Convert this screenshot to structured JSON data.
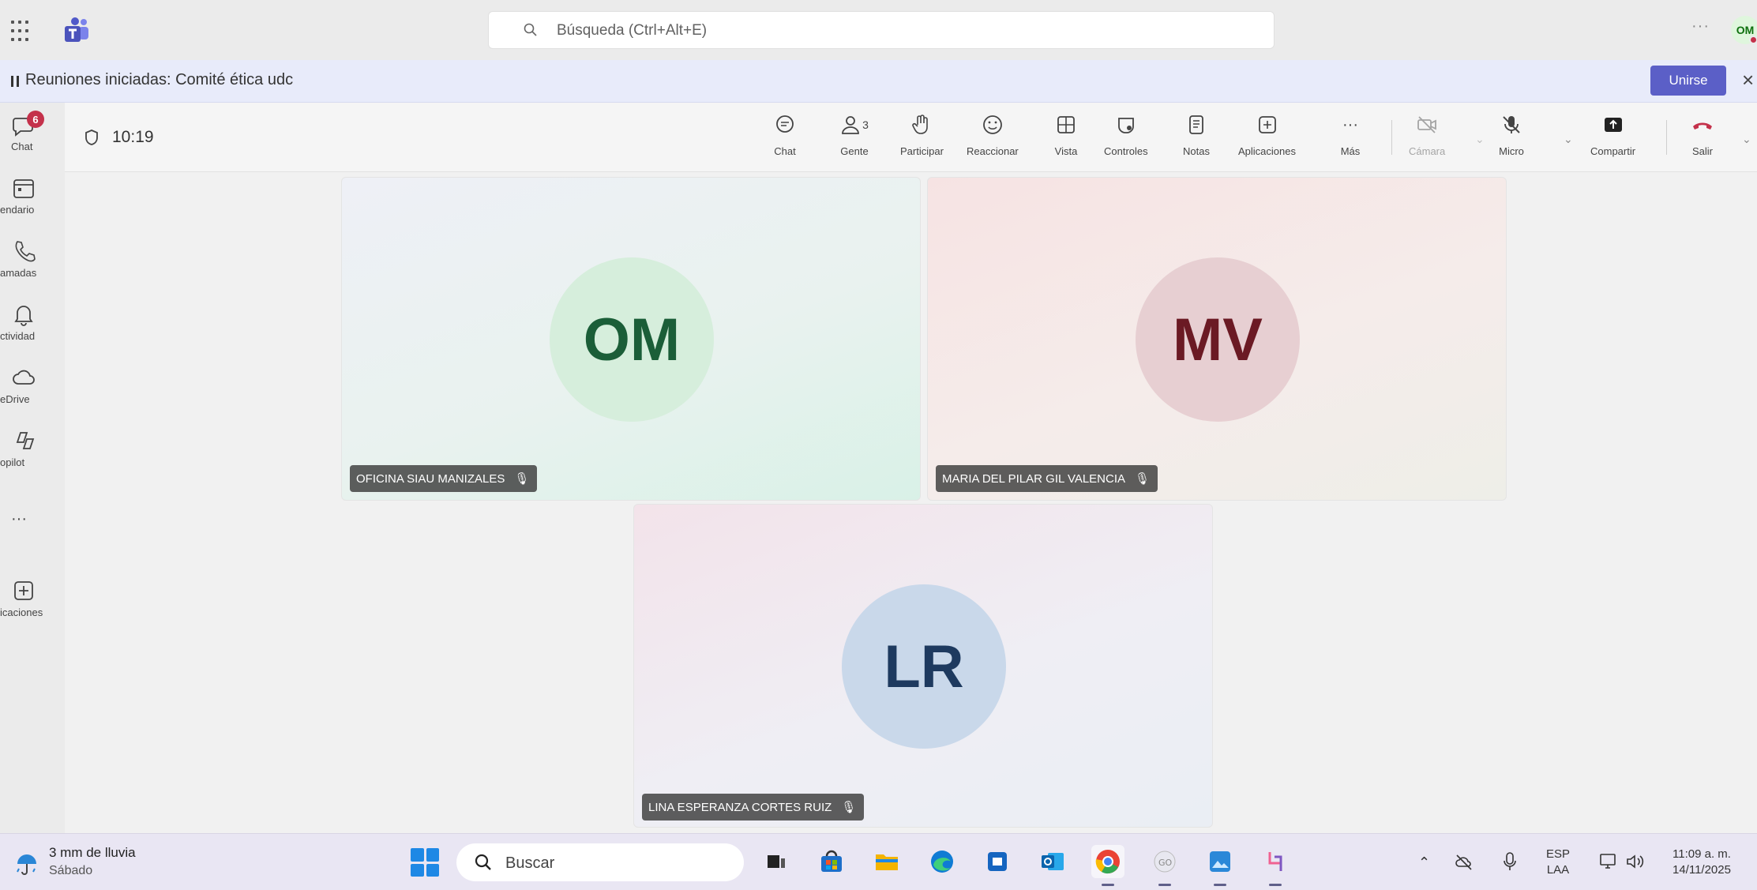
{
  "titlebar": {
    "search_placeholder": "Búsqueda (Ctrl+Alt+E)",
    "more": "···",
    "avatar_initials": "OM"
  },
  "banner": {
    "text": "Reuniones iniciadas: Comité ética udc",
    "join_label": "Unirse",
    "close": "×"
  },
  "rail": {
    "chat_badge": "6",
    "items": [
      {
        "label": "Chat",
        "icon": "chat-icon"
      },
      {
        "label": "endario",
        "icon": "calendar-icon"
      },
      {
        "label": "amadas",
        "icon": "phone-icon"
      },
      {
        "label": "ctividad",
        "icon": "bell-icon"
      },
      {
        "label": "eDrive",
        "icon": "cloud-icon"
      },
      {
        "label": "opilot",
        "icon": "copilot-icon"
      },
      {
        "label": "",
        "icon": "more-icon"
      },
      {
        "label": "icaciones",
        "icon": "add-apps-icon"
      }
    ],
    "more": "···"
  },
  "meeting": {
    "timer": "10:19",
    "people_count": "3",
    "toolbar": {
      "chat": "Chat",
      "people": "Gente",
      "raise": "Participar",
      "react": "Reaccionar",
      "view": "Vista",
      "controls": "Controles",
      "notes": "Notas",
      "apps": "Aplicaciones",
      "more": "Más",
      "camera": "Cámara",
      "mic": "Micro",
      "share": "Compartir",
      "leave": "Salir"
    },
    "participants": [
      {
        "initials": "OM",
        "name": "OFICINA SIAU MANIZALES",
        "avatar_bg": "#d6eedc",
        "avatar_fg": "#1b5e38"
      },
      {
        "initials": "MV",
        "name": "MARIA DEL PILAR GIL VALENCIA",
        "avatar_bg": "#e7cfd2",
        "avatar_fg": "#6b1a24"
      },
      {
        "initials": "LR",
        "name": "LINA ESPERANZA CORTES RUIZ",
        "avatar_bg": "#c9d8ea",
        "avatar_fg": "#1e3a5f"
      }
    ]
  },
  "taskbar": {
    "weather_line1": "3 mm de lluvia",
    "weather_line2": "Sábado",
    "search_label": "Buscar",
    "apps": [
      "file-explorer-dark-icon",
      "store-icon",
      "folder-icon",
      "edge-icon",
      "calendar-app-icon",
      "outlook-icon",
      "chrome-icon",
      "gocam-icon",
      "photos-icon",
      "snipping-icon"
    ],
    "lang_line1": "ESP",
    "lang_line2": "LAA",
    "time": "11:09 a. m.",
    "date": "14/11/2025"
  }
}
